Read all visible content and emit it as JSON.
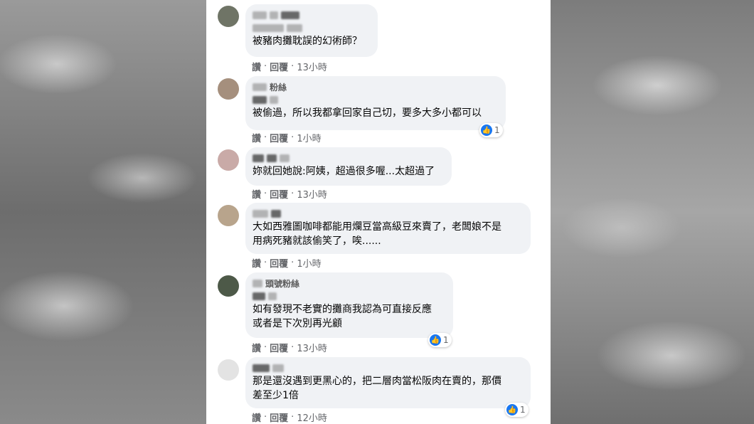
{
  "actions": {
    "like": "讚",
    "reply": "回覆",
    "dot": "·"
  },
  "comments": [
    {
      "text": "被豬肉攤耽誤的幻術師？",
      "time": "13小時",
      "reactions": ""
    },
    {
      "fan_label": "粉絲",
      "text": "被偷過，所以我都拿回家自己切，要多大多小都可以",
      "time": "1小時",
      "reactions": "1"
    },
    {
      "text": "妳就回她說:阿姨，超過很多喔...太超過了",
      "time": "13小時",
      "reactions": ""
    },
    {
      "text": "大如西雅圖咖啡都能用爛豆當高級豆來賣了，老闆娘不是\n用病死豬就該偷笑了，唉......",
      "time": "1小時",
      "reactions": ""
    },
    {
      "fan_label": "頭號粉絲",
      "text": "如有發現不老實的攤商我認為可直接反應\n或者是下次別再光顧",
      "time": "13小時",
      "reactions": "1"
    },
    {
      "text": "那是還沒遇到更黑心的，把二層肉當松阪肉在賣的，那價\n差至少1倍",
      "time": "12小時",
      "reactions": "1"
    }
  ],
  "like_icon": "thumbs-up-icon",
  "colors": {
    "like_blue": "#1877f2",
    "bubble": "#f0f2f5",
    "meta": "#65676b"
  }
}
